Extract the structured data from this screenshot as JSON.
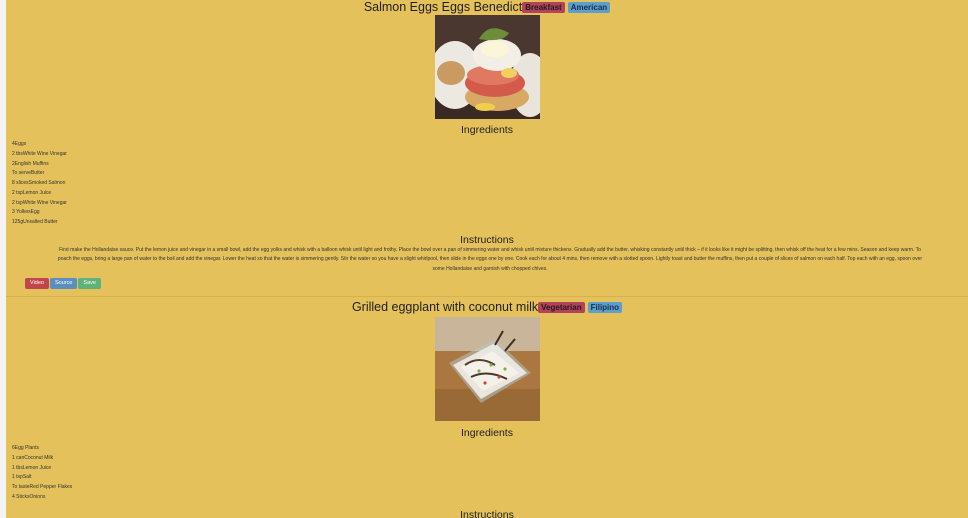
{
  "recipes": [
    {
      "title": "Salmon Eggs Eggs Benedict",
      "category": "Breakfast",
      "area": "American",
      "ingredients_heading": "Ingredients",
      "ingredients": [
        "4Eggs",
        "2 tbsWhite Wine Vinegar",
        "2English Muffins",
        "To serveButter",
        "8 slicesSmoked Salmon",
        "2 tspLemon Juice",
        "2 tspWhite Wine Vinegar",
        "3 YolkesEgg",
        "125gUnsalted Butter"
      ],
      "instructions_heading": "Instructions",
      "instructions": [
        "First make the Hollandaise sauce. Put the lemon juice and vinegar in a small bowl, add the egg yolks and whisk with a balloon whisk until light and frothy. Place the bowl over a pan of simmering water and whisk until mixture thickens. Gradually add the butter, whisking constantly until thick – if it looks like it might be splitting, then whisk off the heat for a few mins. Season and keep warm. To",
        "poach the eggs, bring a large pan of water to the boil and add the vinegar. Lower the heat so that the water is simmering gently. Stir the water so you have a slight whirlpool, then slide in the eggs one by one. Cook each for about 4 mins, then remove with a slotted spoon. Lightly toast and butter the muffins, then put a couple of slices of salmon on each half. Top each with an egg, spoon over",
        "some Hollandaise and garnish with chopped chives."
      ],
      "buttons": {
        "video": "Video",
        "source": "Source",
        "save": "Save"
      }
    },
    {
      "title": "Grilled eggplant with coconut milk",
      "category": "Vegetarian",
      "area": "Filipino",
      "ingredients_heading": "Ingredients",
      "ingredients": [
        "6Egg Plants",
        "1 canCoconut Milk",
        "1 tbsLemon Juice",
        "1 tspSalt",
        "To tasteRed Pepper Flakes",
        "4 SticksOnions"
      ],
      "instructions_heading": "Instructions"
    }
  ],
  "colors": {
    "page_background": "#e4c15a",
    "category_badge": "#b3425a",
    "area_badge": "#5aa0c8",
    "video_button": "#c0464c",
    "source_button": "#5b8fbe",
    "save_button": "#60b27a"
  },
  "images": {
    "recipe_1": "eggs-benedict-photo",
    "recipe_2": "grilled-eggplant-photo"
  }
}
